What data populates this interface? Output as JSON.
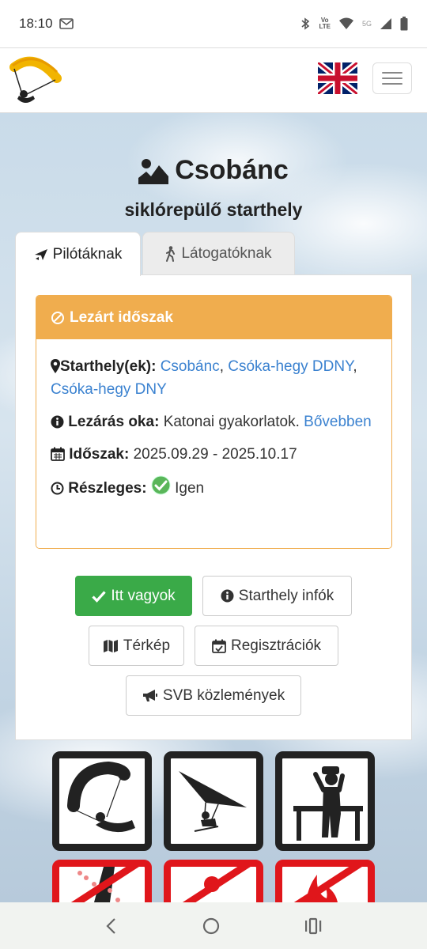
{
  "status": {
    "time": "18:10",
    "lte": "LTE",
    "vo": "Vo",
    "net": "5G"
  },
  "header": {
    "flag": "en-flag",
    "menu": "hamburger-icon"
  },
  "page": {
    "title": "Csobánc",
    "subtitle": "siklórepülő starthely"
  },
  "tabs": [
    {
      "label": "Pilótáknak",
      "icon": "plane-icon"
    },
    {
      "label": "Látogatóknak",
      "icon": "walking-icon"
    }
  ],
  "alert": {
    "heading": "Lezárt időszak",
    "site_label": "Starthely(ek):",
    "sites": [
      "Csobánc",
      "Csóka-hegy DDNY",
      "Csóka-hegy DNY"
    ],
    "site_sep": ", ",
    "reason_label": "Lezárás oka:",
    "reason_text": "Katonai gyakorlatok.",
    "reason_link": "Bővebben",
    "period_label": "Időszak:",
    "period_value": "2025.09.29 - 2025.10.17",
    "partial_label": "Részleges:",
    "partial_value": "Igen"
  },
  "buttons": {
    "here": "Itt vagyok",
    "info": "Starthely infók",
    "map": "Térkép",
    "registrations": "Regisztrációk",
    "notices": "SVB közlemények"
  },
  "colors": {
    "warning": "#f0ad4e",
    "success": "#3aaa48",
    "link": "#3b82d0",
    "prohibit": "#e0161b"
  }
}
